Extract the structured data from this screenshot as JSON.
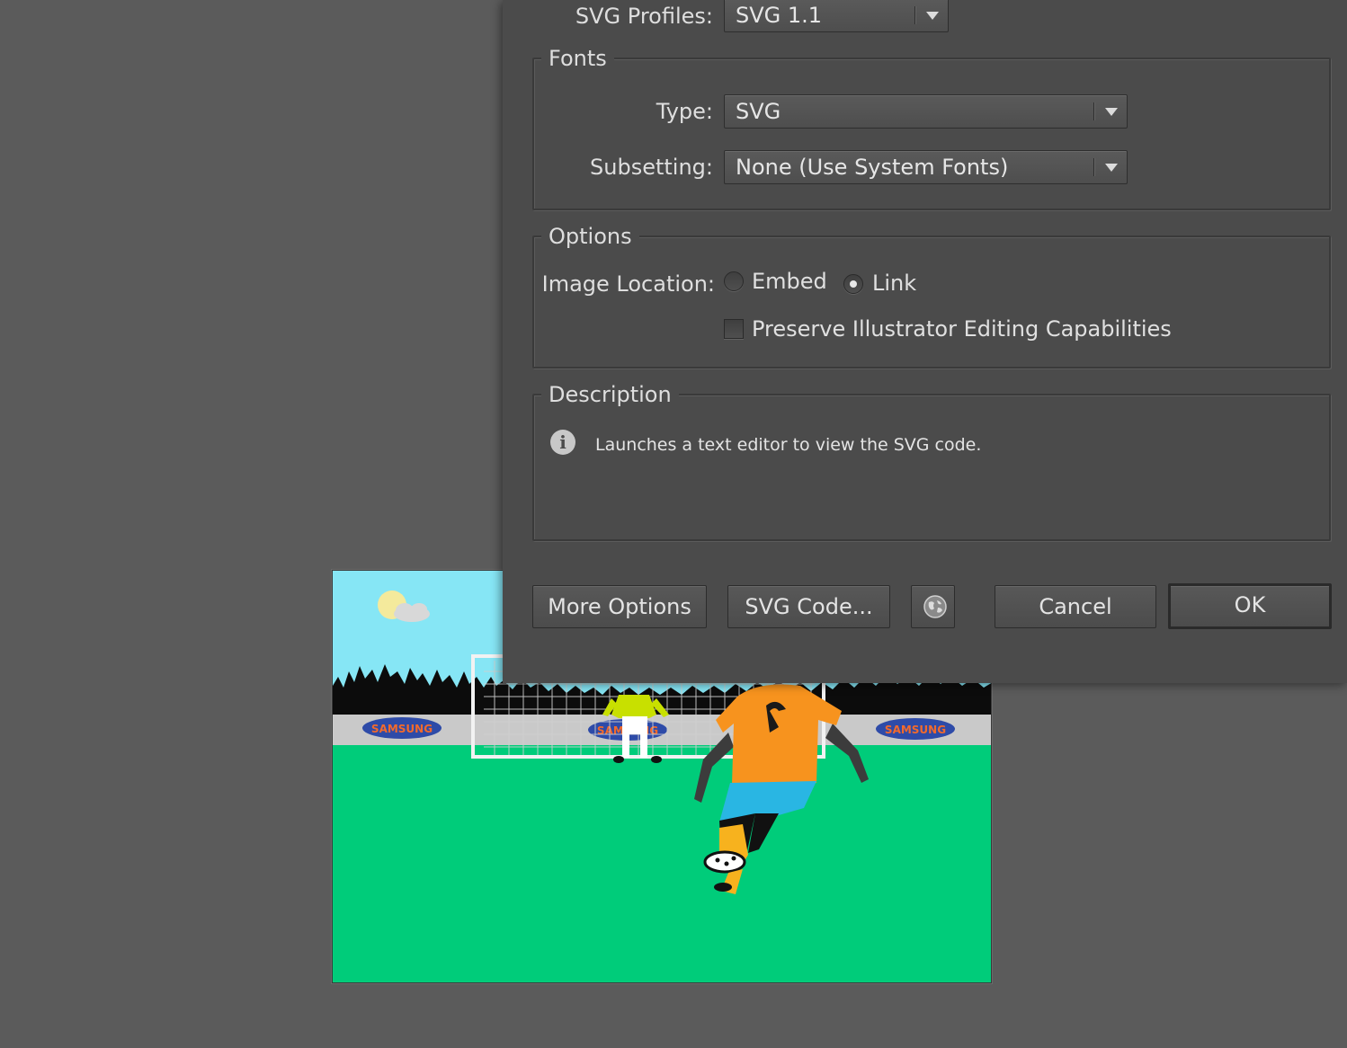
{
  "dialog": {
    "svg_profiles": {
      "label": "SVG Profiles:",
      "value": "SVG 1.1"
    },
    "fonts": {
      "legend": "Fonts",
      "type": {
        "label": "Type:",
        "value": "SVG"
      },
      "subsetting": {
        "label": "Subsetting:",
        "value": "None (Use System Fonts)"
      }
    },
    "options": {
      "legend": "Options",
      "image_location_label": "Image Location:",
      "embed_label": "Embed",
      "link_label": "Link",
      "image_location_selected": "Link",
      "preserve_label": "Preserve Illustrator Editing Capabilities",
      "preserve_checked": false
    },
    "description": {
      "legend": "Description",
      "text": "Launches a text editor to view the SVG code."
    },
    "buttons": {
      "more_options": "More Options",
      "svg_code": "SVG Code...",
      "web_preview_icon": "globe-icon",
      "cancel": "Cancel",
      "ok": "OK"
    }
  },
  "artwork": {
    "ad_board_text": "SAMSUNG",
    "colors": {
      "sky": "#86e6f5",
      "pitch": "#00cc7a",
      "ad_board": "#c9c9c9",
      "logo_ellipse": "#2e4ba8",
      "logo_text": "#f26a2c",
      "striker_shirt": "#f7931e",
      "striker_shorts": "#29b6e3",
      "keeper_shirt": "#c8e000"
    }
  }
}
